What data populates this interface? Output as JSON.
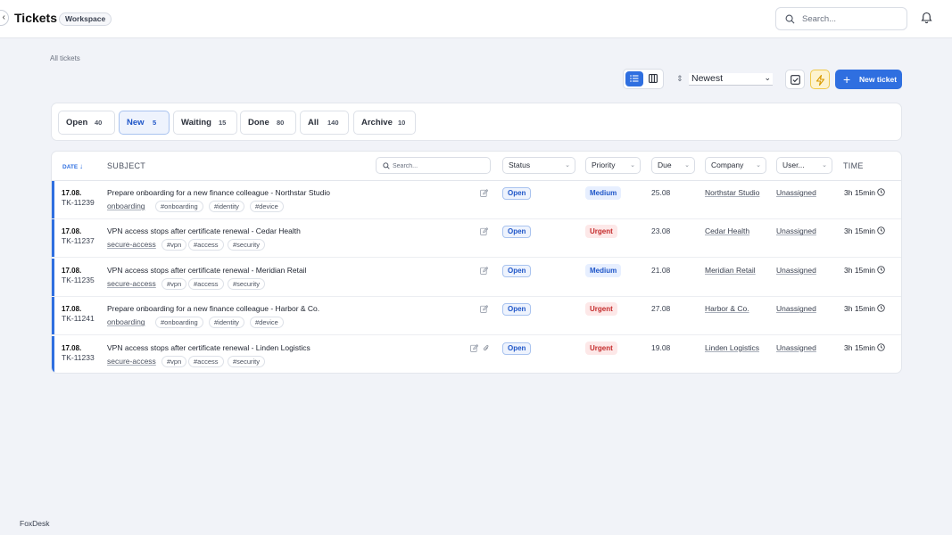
{
  "header": {
    "title": "Tickets",
    "workspace_badge": "Workspace",
    "search_placeholder": "Search..."
  },
  "breadcrumb": "All tickets",
  "toolbar": {
    "sort_value": "Newest",
    "new_ticket_label": "New ticket"
  },
  "tabs": [
    {
      "label": "Open",
      "count": "40",
      "active": false
    },
    {
      "label": "New",
      "count": "5",
      "active": true
    },
    {
      "label": "Waiting",
      "count": "15",
      "active": false
    },
    {
      "label": "Done",
      "count": "80",
      "active": false
    },
    {
      "label": "All",
      "count": "140",
      "active": false
    },
    {
      "label": "Archive",
      "count": "10",
      "active": false
    }
  ],
  "table": {
    "columns": {
      "date": "DATE",
      "subject": "SUBJECT",
      "search_placeholder": "Search...",
      "status": "Status",
      "priority": "Priority",
      "due": "Due",
      "company": "Company",
      "user": "User...",
      "time": "TIME"
    },
    "rows": [
      {
        "date": "17.08.",
        "id": "TK-11239",
        "subject": "Prepare onboarding for a new finance colleague - Northstar Studio",
        "category": "onboarding",
        "tags": [
          "#onboarding",
          "#identity",
          "#device"
        ],
        "status": "Open",
        "priority": "Medium",
        "due": "25.08",
        "company": "Northstar Studio",
        "user": "Unassigned",
        "time": "3h 15min",
        "attachment": false
      },
      {
        "date": "17.08.",
        "id": "TK-11237",
        "subject": "VPN access stops after certificate renewal - Cedar Health",
        "category": "secure-access",
        "tags": [
          "#vpn",
          "#access",
          "#security"
        ],
        "status": "Open",
        "priority": "Urgent",
        "due": "23.08",
        "company": "Cedar Health",
        "user": "Unassigned",
        "time": "3h 15min",
        "attachment": false
      },
      {
        "date": "17.08.",
        "id": "TK-11235",
        "subject": "VPN access stops after certificate renewal - Meridian Retail",
        "category": "secure-access",
        "tags": [
          "#vpn",
          "#access",
          "#security"
        ],
        "status": "Open",
        "priority": "Medium",
        "due": "21.08",
        "company": "Meridian Retail",
        "user": "Unassigned",
        "time": "3h 15min",
        "attachment": false
      },
      {
        "date": "17.08.",
        "id": "TK-11241",
        "subject": "Prepare onboarding for a new finance colleague - Harbor & Co.",
        "category": "onboarding",
        "tags": [
          "#onboarding",
          "#identity",
          "#device"
        ],
        "status": "Open",
        "priority": "Urgent",
        "due": "27.08",
        "company": "Harbor & Co.",
        "user": "Unassigned",
        "time": "3h 15min",
        "attachment": false
      },
      {
        "date": "17.08.",
        "id": "TK-11233",
        "subject": "VPN access stops after certificate renewal - Linden Logistics",
        "category": "secure-access",
        "tags": [
          "#vpn",
          "#access",
          "#security"
        ],
        "status": "Open",
        "priority": "Urgent",
        "due": "19.08",
        "company": "Linden Logistics",
        "user": "Unassigned",
        "time": "3h 15min",
        "attachment": true
      }
    ]
  },
  "footer": "FoxDesk",
  "colors": {
    "accent": "#2f6fe0",
    "urgent": "#c42b2b",
    "background": "#f1f3f8"
  }
}
